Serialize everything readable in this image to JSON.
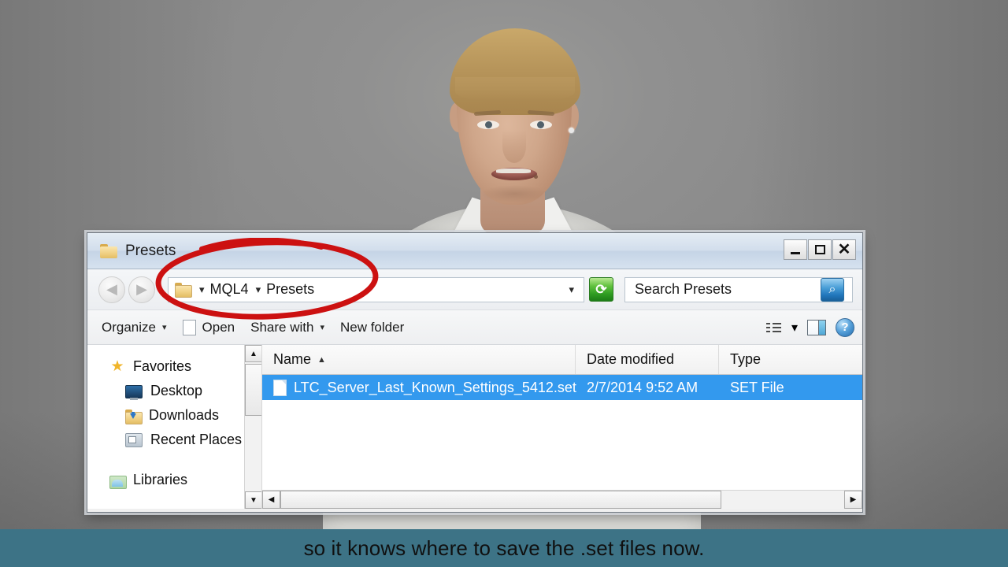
{
  "window": {
    "title": "Presets",
    "title_icon": "folder-icon",
    "controls": {
      "minimize": "_",
      "maximize": "□",
      "close": "✕"
    }
  },
  "navigation": {
    "back_label": "◀",
    "forward_label": "▶",
    "address": {
      "folder_icon": "folder-icon",
      "separator": "▾",
      "crumbs": [
        "MQL4",
        "Presets"
      ],
      "crumb1": "MQL4",
      "crumb2": "Presets",
      "dropdown": "▾"
    },
    "refresh_label": "⟳",
    "search": {
      "placeholder": "Search Presets",
      "value": "",
      "button_icon": "search-icon",
      "button_glyph": "⌕"
    }
  },
  "commandbar": {
    "organize": "Organize",
    "organize_caret": "▾",
    "open": "Open",
    "share_with": "Share with",
    "share_caret": "▾",
    "new_folder": "New folder",
    "view_caret": "▾",
    "view_icon": "view-layout-icon",
    "preview_pane_icon": "preview-pane-icon",
    "help_label": "?"
  },
  "navpane": {
    "items": [
      {
        "label": "Favorites",
        "icon": "star-icon",
        "level": "group"
      },
      {
        "label": "Desktop",
        "icon": "desktop-icon",
        "level": "sub"
      },
      {
        "label": "Downloads",
        "icon": "downloads-folder-icon",
        "level": "sub"
      },
      {
        "label": "Recent Places",
        "icon": "recent-places-icon",
        "level": "sub"
      },
      {
        "label": "Libraries",
        "icon": "libraries-icon",
        "level": "group"
      }
    ],
    "item0": "Favorites",
    "item1": "Desktop",
    "item2": "Downloads",
    "item3": "Recent Places",
    "item4": "Libraries",
    "scroll_up": "▲",
    "scroll_down": "▼"
  },
  "filelist": {
    "columns": [
      "Name",
      "Date modified",
      "Type"
    ],
    "col_name": "Name",
    "col_date": "Date modified",
    "col_type": "Type",
    "sort_caret": "▲",
    "rows": [
      {
        "name": "LTC_Server_Last_Known_Settings_5412.set",
        "date_modified": "2/7/2014 9:52 AM",
        "type": "SET File",
        "selected": true,
        "icon": "file-icon"
      }
    ],
    "row0_name": "LTC_Server_Last_Known_Settings_5412.set",
    "row0_date": "2/7/2014 9:52 AM",
    "row0_type": "SET File",
    "scroll_left": "◀",
    "scroll_right": "▶",
    "selection_color": "#3399ee"
  },
  "annotation": {
    "shape": "ellipse",
    "color": "#cc1111",
    "target": "address bar breadcrumb MQL4 > Presets"
  },
  "caption": {
    "text": "so it knows where to save the .set files now.",
    "background_color": "#3d7386",
    "text_color": "#101010"
  }
}
